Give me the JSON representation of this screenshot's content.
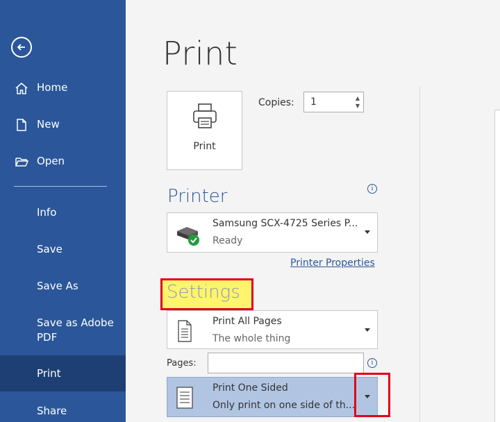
{
  "sidebar": {
    "back_label": "",
    "items": [
      {
        "label": "Home"
      },
      {
        "label": "New"
      },
      {
        "label": "Open"
      },
      {
        "label": "Info"
      },
      {
        "label": "Save"
      },
      {
        "label": "Save As"
      },
      {
        "label": "Save as Adobe PDF"
      },
      {
        "label": "Print"
      },
      {
        "label": "Share"
      }
    ]
  },
  "main": {
    "title": "Print",
    "print_button_label": "Print",
    "copies_label": "Copies:",
    "copies_value": "1",
    "printer_heading": "Printer",
    "printer": {
      "name": "Samsung SCX-4725 Series P...",
      "status": "Ready"
    },
    "printer_properties_label": "Printer Properties",
    "settings_heading": "Settings",
    "pages_setting": {
      "title": "Print All Pages",
      "subtitle": "The whole thing"
    },
    "pages_label": "Pages:",
    "pages_value": "",
    "sides_setting": {
      "title": "Print One Sided",
      "subtitle": "Only print on one side of th..."
    }
  },
  "colors": {
    "sidebar_bg": "#2b579a",
    "selected_bg": "#1e3f73",
    "accent": "#2b579a",
    "highlight_yellow": "#fff46b",
    "annotation_red": "#e0001b"
  },
  "icons": [
    "back-arrow-icon",
    "home-icon",
    "new-document-icon",
    "open-folder-icon",
    "printer-icon",
    "info-icon",
    "printer-ready-icon",
    "pages-icon",
    "one-sided-icon",
    "dropdown-caret-icon"
  ]
}
